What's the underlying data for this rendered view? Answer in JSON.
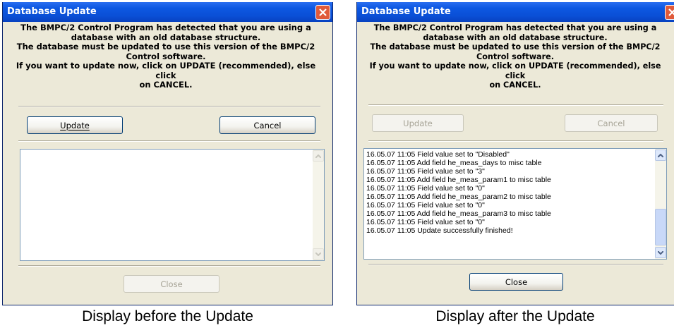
{
  "before": {
    "title": "Database Update",
    "message": "The BMPC/2 Control Program has detected that you are using a\ndatabase with an old database structure.\nThe database must be updated to use this version of the BMPC/2\nControl software.\nIf you want to update now, click on UPDATE (recommended), else click\non CANCEL.",
    "update_label": "Update",
    "cancel_label": "Cancel",
    "close_label": "Close",
    "caption": "Display before the Update"
  },
  "after": {
    "title": "Database Update",
    "message": "The BMPC/2 Control Program has detected that you are using a\ndatabase with an old database structure.\nThe database must be updated to use this version of the BMPC/2\nControl software.\nIf you want to update now, click on UPDATE (recommended), else click\non CANCEL.",
    "update_label": "Update",
    "cancel_label": "Cancel",
    "close_label": "Close",
    "caption": "Display after the Update",
    "log": [
      "16.05.07 11:05  Field value set to \"Disabled\"",
      "16.05.07 11:05  Add field he_meas_days to misc table",
      "16.05.07 11:05  Field value set to \"3\"",
      "16.05.07 11:05  Add field he_meas_param1 to misc table",
      "16.05.07 11:05  Field value set to \"0\"",
      "16.05.07 11:05  Add field he_meas_param2 to misc table",
      "16.05.07 11:05  Field value set to \"0\"",
      "16.05.07 11:05  Add field he_meas_param3 to misc table",
      "16.05.07 11:05  Field value set to \"0\"",
      "16.05.07 11:05  Update successfully finished!"
    ]
  },
  "icons": {
    "close": "close-x-icon",
    "scroll_up": "chevron-up-icon",
    "scroll_down": "chevron-down-icon"
  },
  "colors": {
    "titlebar": "#0a4fd6",
    "dialog_bg": "#ece9d8",
    "close_button": "#e05a3a"
  }
}
